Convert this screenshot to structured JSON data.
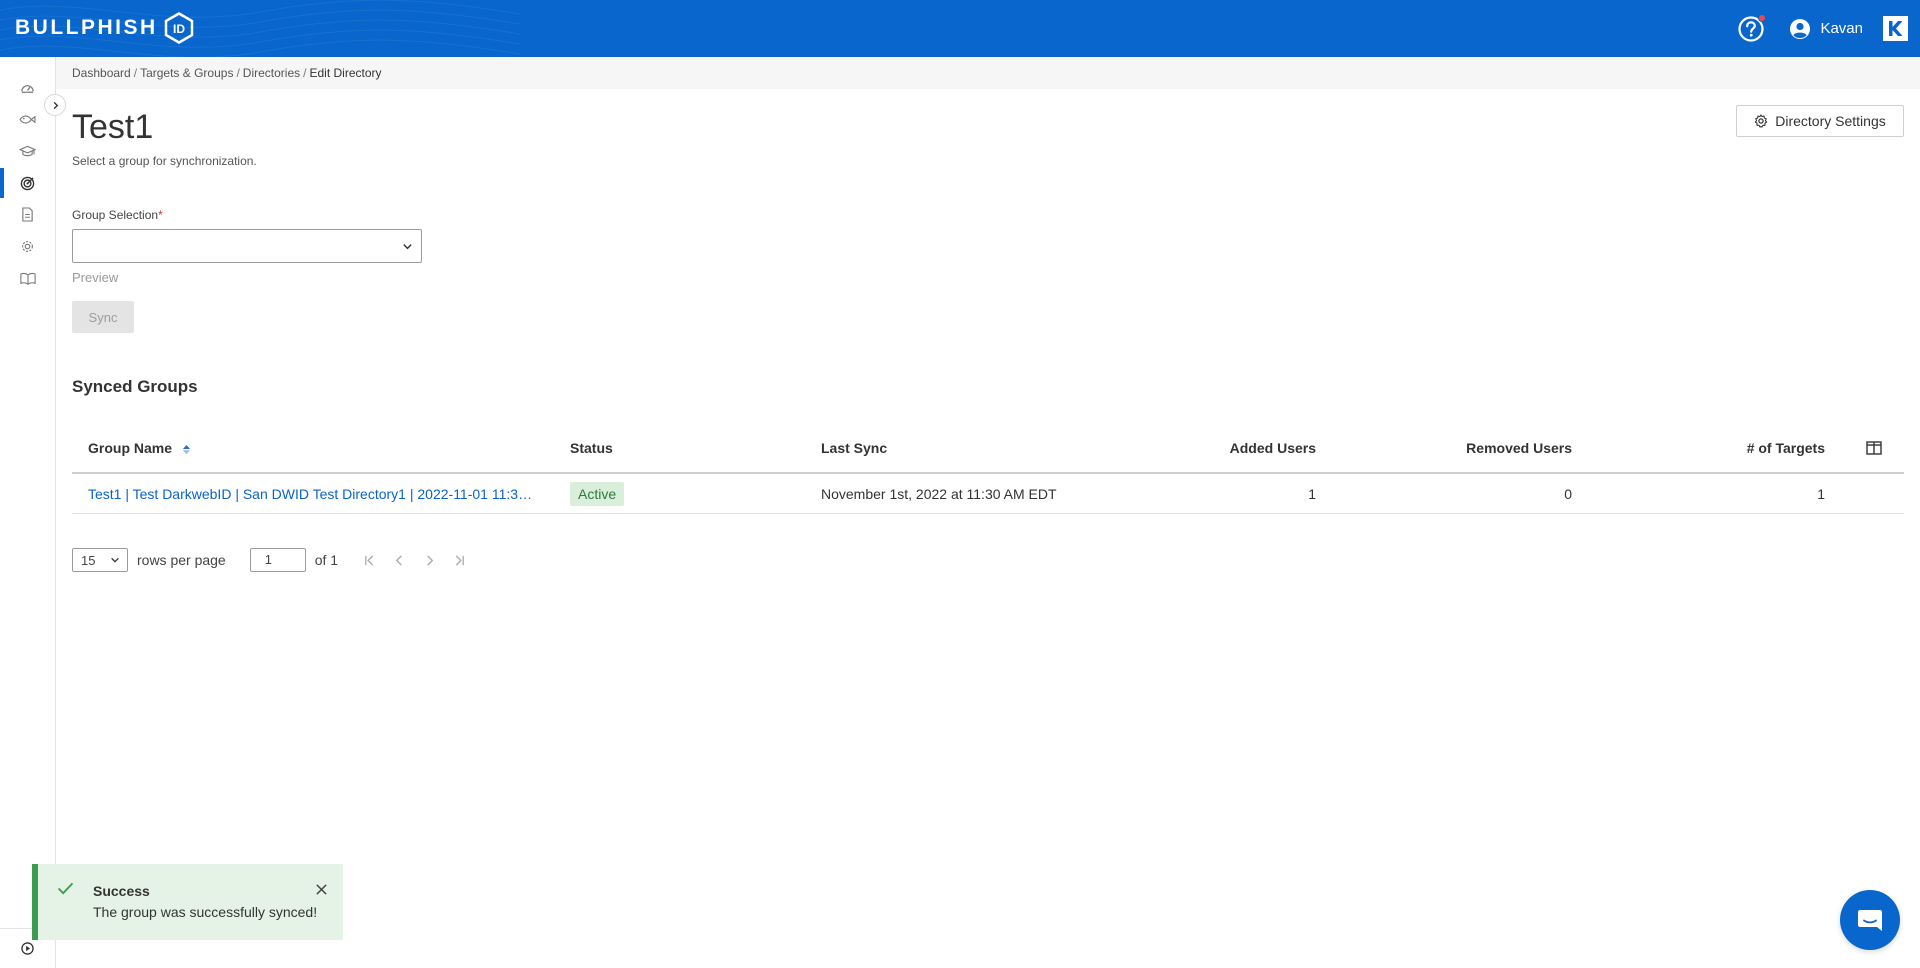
{
  "header": {
    "logo_text": "BULLPHISH",
    "logo_badge": "ID",
    "user_name": "Kavan",
    "help_icon": "question-circle-icon",
    "user_icon": "user-circle-icon",
    "brand_icon": "kaseya-k-icon",
    "brand_color": "#0866cc",
    "notification_color": "#e94b4b"
  },
  "sidebar": {
    "items": [
      {
        "name": "dashboard",
        "icon": "speedometer-icon"
      },
      {
        "name": "campaigns",
        "icon": "phishing-hook-icon"
      },
      {
        "name": "training",
        "icon": "graduation-cap-icon"
      },
      {
        "name": "targets",
        "icon": "target-icon",
        "active": true
      },
      {
        "name": "reports",
        "icon": "document-icon"
      },
      {
        "name": "settings",
        "icon": "gear-icon"
      },
      {
        "name": "resources",
        "icon": "book-icon"
      }
    ],
    "bottom_icon": "play-circle-icon"
  },
  "breadcrumb": {
    "items": [
      "Dashboard",
      "Targets & Groups",
      "Directories"
    ],
    "current": "Edit Directory",
    "separator": "/"
  },
  "page": {
    "title": "Test1",
    "subtitle": "Select a group for synchronization.",
    "settings_button": "Directory Settings"
  },
  "form": {
    "group_label": "Group Selection",
    "required_mark": "*",
    "group_value": "",
    "preview_label": "Preview",
    "sync_label": "Sync"
  },
  "synced_groups": {
    "title": "Synced Groups",
    "columns": [
      "Group Name",
      "Status",
      "Last Sync",
      "Added Users",
      "Removed Users",
      "# of Targets"
    ],
    "rows": [
      {
        "group_name": "Test1 | Test DarkwebID | San DWID Test Directory1 | 2022-11-01 11:30:...",
        "status": "Active",
        "last_sync": "November 1st, 2022 at 11:30 AM EDT",
        "added_users": "1",
        "removed_users": "0",
        "targets": "1"
      }
    ],
    "status_color": "#2a7a3a"
  },
  "pagination": {
    "rows_per_page": "15",
    "rows_label": "rows per page",
    "current_page": "1",
    "of_label": "of 1"
  },
  "toast": {
    "title": "Success",
    "message": "The group was successfully synced!",
    "accent_color": "#3d9b4f"
  }
}
